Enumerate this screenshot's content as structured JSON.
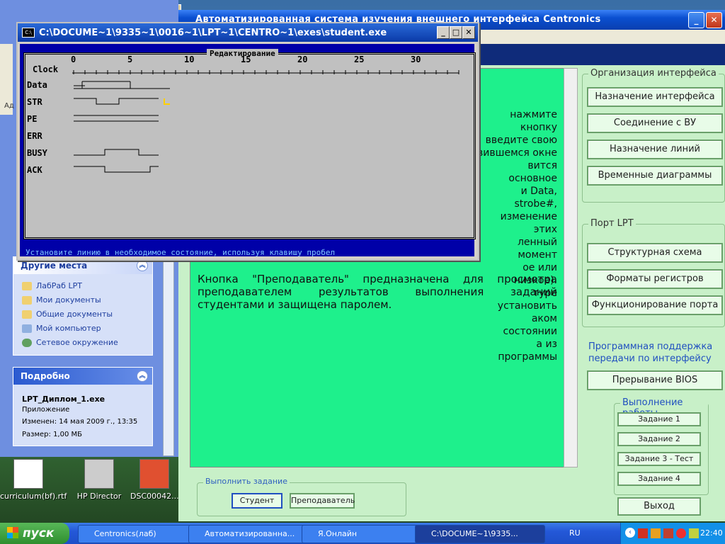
{
  "desktop_icons": [
    {
      "label": "curriculum(bf).rtf"
    },
    {
      "label": "HP Director"
    },
    {
      "label": "DSC00042..."
    }
  ],
  "app": {
    "title": "Автоматизированная система изучения внешнего интерфейса Centronics",
    "text_p1": [
      "нажмите кнопку",
      "введите свою",
      "вившемся окне",
      "вится основное",
      "и Data, strobe#,",
      "изменение этих",
      "ленный момент",
      "ое или низкое).",
      "туре установить",
      "аком состоянии",
      "а из программы"
    ],
    "text_p2": "Кнопка \"Преподаватель\" предназначена для просмотра преподавателем результатов выполнения заданий студентами и защищена паролем.",
    "groups": {
      "org": {
        "legend": "Организация интерфейса",
        "buttons": [
          "Назначение интерфейса",
          "Соединение с ВУ",
          "Назначение линий",
          "Временные диаграммы"
        ]
      },
      "lpt": {
        "legend": "Порт LPT",
        "buttons": [
          "Структурная схема",
          "Форматы регистров",
          "Функционирование порта"
        ]
      },
      "prog": {
        "legend": "Программная поддержка передачи по интерфейсу",
        "buttons": [
          "Прерывание BIOS"
        ]
      },
      "work": {
        "legend": "Выполнение работы",
        "buttons": [
          "Задание 1",
          "Задание 2",
          "Задание 3 - Тест",
          "Задание 4"
        ]
      },
      "run": {
        "legend": "Выполнить задание",
        "student": "Студент",
        "teacher": "Преподаватель"
      }
    },
    "exit": "Выход"
  },
  "explorer": {
    "other_places": {
      "title": "Другие места",
      "links": [
        "ЛабРаб LPT",
        "Мои документы",
        "Общие документы",
        "Мой компьютер",
        "Сетевое окружение"
      ]
    },
    "details": {
      "title": "Подробно",
      "name": "LPT_Диплом_1.exe",
      "type": "Приложение",
      "modified": "Изменен: 14 мая 2009 г., 13:35",
      "size": "Размер: 1,00 МБ"
    }
  },
  "console": {
    "title": "C:\\DOCUME~1\\9335~1\\0016~1\\LPT~1\\CENTRO~1\\exes\\student.exe",
    "frame_title": "Редактирование",
    "clock_label": "Clock",
    "ticks": [
      "0",
      "5",
      "10",
      "15",
      "20",
      "25",
      "30"
    ],
    "signals": [
      "Data",
      "STR",
      "PE",
      "ERR",
      "BUSY",
      "ACK"
    ],
    "status": "Установите линию в необходимое состояние, используя клавишу пробел"
  },
  "taskbar": {
    "start": "пуск",
    "tasks": [
      {
        "label": "Centronics(лаб)"
      },
      {
        "label": "Автоматизированна..."
      },
      {
        "label": "Я.Онлайн"
      },
      {
        "label": "C:\\DOCUME~1\\9335..."
      }
    ],
    "lang": "RU",
    "clock": "22:40"
  },
  "colors": {
    "green_panel": "#1ef08c",
    "console_bg": "#0000a8",
    "console_inner": "#c0c0c0",
    "xp_blue": "#2458d8"
  }
}
